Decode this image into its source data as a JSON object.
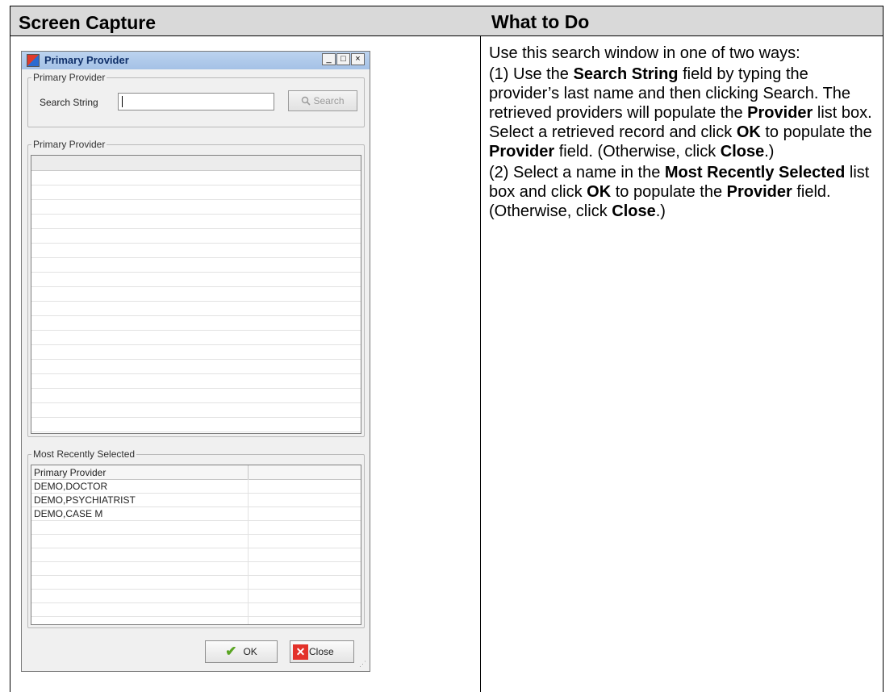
{
  "table": {
    "col1_header": "Screen Capture",
    "col2_header": "What to Do"
  },
  "dialog": {
    "title": "Primary Provider",
    "window_buttons": {
      "minimize": "_",
      "maximize": "□",
      "close": "×"
    },
    "search_group_label": "Primary Provider",
    "search_label": "Search String",
    "search_value": "",
    "search_button": "Search",
    "results_group_label": "Primary Provider",
    "recent_group_label": "Most Recently Selected",
    "recent_column_header": "Primary Provider",
    "recent_rows": [
      "DEMO,DOCTOR",
      "DEMO,PSYCHIATRIST",
      "DEMO,CASE M"
    ],
    "ok_button": "OK",
    "close_button": "Close"
  },
  "instructions": {
    "p1": "Use this search window in one of two ways:",
    "p2": {
      "t1": "(1) Use the ",
      "b1": "Search String",
      "t2": " field by typing the provider’s last name and then clicking Search. The retrieved providers will populate the ",
      "b2": "Provider",
      "t3": " list box. Select a retrieved record and click ",
      "b3": "OK",
      "t4": " to populate the ",
      "b4": "Provider",
      "t5": " field. (Otherwise, click ",
      "b5": "Close",
      "t6": ".)"
    },
    "p3": {
      "t1": "(2) Select a name in the ",
      "b1": "Most Recently Selected",
      "t2": " list box and click ",
      "b2": "OK",
      "t3": " to populate the ",
      "b3": "Provider",
      "t4": " field. (Otherwise, click ",
      "b4": "Close",
      "t5": ".)"
    }
  }
}
